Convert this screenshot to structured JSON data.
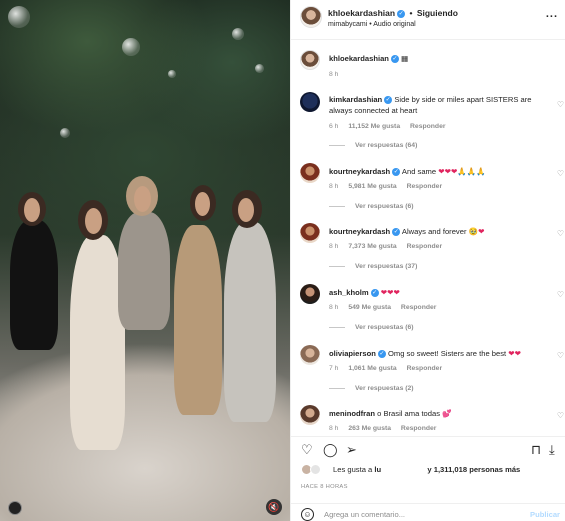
{
  "photo": {
    "left_icon": "user-tag-icon",
    "right_icon": "volume-muted-icon"
  },
  "header": {
    "username": "khloekardashian",
    "separator": "•",
    "follow_status": "Siguiendo",
    "audio": "mimabycami • Audio original",
    "more_icon": "more-icon",
    "more_label": "..."
  },
  "caption": {
    "username": "khloekardashian",
    "text": "▦",
    "time": "8 h"
  },
  "comments": [
    {
      "username": "kimkardashian",
      "text": "Side by side or miles apart SISTERS are always connected at heart",
      "time": "6 h",
      "likes": "11,152 Me gusta",
      "reply": "Responder",
      "replies": "Ver respuestas (64)"
    },
    {
      "username": "kourtneykardash",
      "text": "And same",
      "emoji": "❤❤❤🙏🙏🙏",
      "time": "8 h",
      "likes": "5,981 Me gusta",
      "reply": "Responder",
      "replies": "Ver respuestas (6)"
    },
    {
      "username": "kourtneykardash",
      "text": "Always and forever",
      "emoji": "🥹❤",
      "time": "8 h",
      "likes": "7,373 Me gusta",
      "reply": "Responder",
      "replies": "Ver respuestas (37)"
    },
    {
      "username": "ash_kholm",
      "text": "",
      "emoji": "❤❤❤",
      "time": "8 h",
      "likes": "549 Me gusta",
      "reply": "Responder",
      "replies": "Ver respuestas (6)"
    },
    {
      "username": "oliviapierson",
      "text": "Omg so sweet! Sisters are the best",
      "emoji": "❤❤",
      "time": "7 h",
      "likes": "1,061 Me gusta",
      "reply": "Responder",
      "replies": "Ver respuestas (2)"
    },
    {
      "username": "meninodfran",
      "text": "o Brasil ama todas",
      "emoji": "💕",
      "time": "8 h",
      "likes": "263 Me gusta",
      "reply": "Responder"
    }
  ],
  "actions": {
    "like_icon": "heart-icon",
    "comment_icon": "comment-icon",
    "share_icon": "share-icon",
    "save_icon": "bookmark-icon",
    "download_icon": "download-icon"
  },
  "likes": {
    "prefix": "Les gusta a",
    "name": "lu",
    "suffix": "y 1,311,018 personas más"
  },
  "post_time": "HACE 8 HORAS",
  "add_comment": {
    "placeholder": "Agrega un comentario...",
    "publish": "Publicar"
  },
  "colors": {
    "verified": "#3897f0",
    "heart": "#e0245e",
    "publish_disabled": "#b3dbff",
    "meta_gray": "#8e8e8e"
  }
}
